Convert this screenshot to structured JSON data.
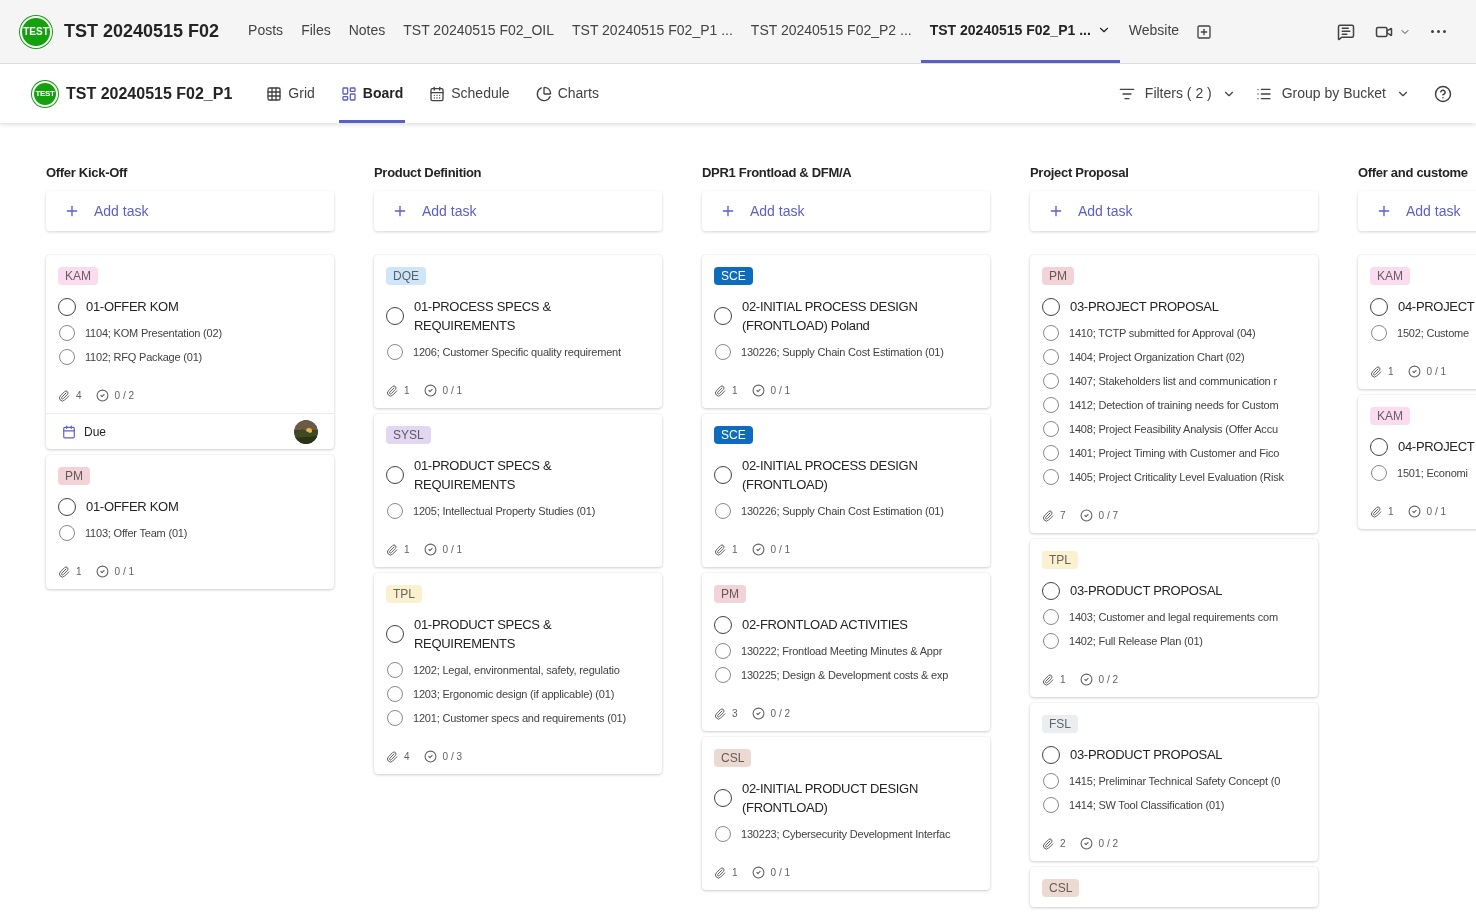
{
  "team": {
    "logo_text": "TEST",
    "name": "TST 20240515 F02"
  },
  "channel_tabs": [
    {
      "label": "Posts",
      "selected": false
    },
    {
      "label": "Files",
      "selected": false
    },
    {
      "label": "Notes",
      "selected": false
    },
    {
      "label": "TST 20240515 F02_OIL",
      "selected": false
    },
    {
      "label": "TST 20240515 F02_P1 ...",
      "selected": false
    },
    {
      "label": "TST 20240515 F02_P2 ...",
      "selected": false
    },
    {
      "label": "TST 20240515 F02_P1 ...",
      "selected": true
    },
    {
      "label": "Website",
      "selected": false
    }
  ],
  "plan": {
    "logo_text": "TEST",
    "name": "TST 20240515 F02_P1"
  },
  "views": [
    {
      "kind": "grid",
      "label": "Grid",
      "selected": false
    },
    {
      "kind": "board",
      "label": "Board",
      "selected": true
    },
    {
      "kind": "schedule",
      "label": "Schedule",
      "selected": false
    },
    {
      "kind": "charts",
      "label": "Charts",
      "selected": false
    }
  ],
  "filters": "Filters ( 2 )",
  "group_by": "Group by Bucket",
  "columns": [
    {
      "title": "Offer Kick-Off",
      "add_label": "Add task",
      "cards": [
        {
          "tag": {
            "label": "KAM",
            "color": "#fbdcef"
          },
          "title": "01-OFFER KOM",
          "done": false,
          "subtasks": [
            {
              "text": "1104; KOM Presentation (02)",
              "done": false
            },
            {
              "text": "1102; RFQ Package (01)",
              "done": false
            }
          ],
          "attachments": "4",
          "checklist": "0 / 2",
          "due": "Due"
        },
        {
          "tag": {
            "label": "PM",
            "color": "#f1d3d8"
          },
          "title": "01-OFFER KOM",
          "done": false,
          "subtasks": [
            {
              "text": "1103; Offer Team (01)",
              "done": false
            }
          ],
          "attachments": "1",
          "checklist": "0 / 1"
        }
      ]
    },
    {
      "title": "Product Definition",
      "add_label": "Add task",
      "cards": [
        {
          "tag": {
            "label": "DQE",
            "color": "#cfe6f8"
          },
          "title": "01-PROCESS SPECS & REQUIREMENTS",
          "done": false,
          "subtasks": [
            {
              "text": "1206; Customer Specific quality requirement",
              "done": false
            }
          ],
          "attachments": "1",
          "checklist": "0 / 1"
        },
        {
          "tag": {
            "label": "SYSL",
            "color": "#e3d6f0"
          },
          "title": "01-PRODUCT SPECS & REQUIREMENTS",
          "done": false,
          "subtasks": [
            {
              "text": "1205; Intellectual Property Studies (01)",
              "done": false
            }
          ],
          "attachments": "1",
          "checklist": "0 / 1"
        },
        {
          "tag": {
            "label": "TPL",
            "color": "#fbf0cf"
          },
          "title": "01-PRODUCT SPECS & REQUIREMENTS",
          "done": false,
          "subtasks": [
            {
              "text": "1202; Legal, environmental, safety, regulatio",
              "done": false
            },
            {
              "text": "1203; Ergonomic design (if applicable) (01)",
              "done": false
            },
            {
              "text": "1201; Customer specs and requirements (01)",
              "done": false
            }
          ],
          "attachments": "4",
          "checklist": "0 / 3"
        }
      ]
    },
    {
      "title": "DPR1 Frontload & DFM/A",
      "add_label": "Add task",
      "cards": [
        {
          "tag": {
            "label": "SCE",
            "color": "#0f6cbd"
          },
          "title": "02-INITIAL PROCESS DESIGN (FRONTLOAD) Poland",
          "done": false,
          "subtasks": [
            {
              "text": "130226; Supply Chain Cost Estimation (01)",
              "done": false
            }
          ],
          "attachments": "1",
          "checklist": "0 / 1"
        },
        {
          "tag": {
            "label": "SCE",
            "color": "#0f6cbd"
          },
          "title": "02-INITIAL PROCESS DESIGN (FRONTLOAD)",
          "done": false,
          "subtasks": [
            {
              "text": "130226; Supply Chain Cost Estimation (01)",
              "done": false
            }
          ],
          "attachments": "1",
          "checklist": "0 / 1"
        },
        {
          "tag": {
            "label": "PM",
            "color": "#f1d3d8"
          },
          "title": "02-FRONTLOAD ACTIVITIES",
          "done": false,
          "subtasks": [
            {
              "text": "130222; Frontload Meeting Minutes & Appr",
              "done": false
            },
            {
              "text": "130225; Design & Development costs & exp",
              "done": false
            }
          ],
          "attachments": "3",
          "checklist": "0 / 2"
        },
        {
          "tag": {
            "label": "CSL",
            "color": "#ecd9d1"
          },
          "title": "02-INITIAL PRODUCT DESIGN (FRONTLOAD)",
          "done": false,
          "subtasks": [
            {
              "text": "130223; Cybersecurity Development Interfac",
              "done": false
            }
          ],
          "attachments": "1",
          "checklist": "0 / 1"
        }
      ]
    },
    {
      "title": "Project Proposal",
      "add_label": "Add task",
      "cards": [
        {
          "tag": {
            "label": "PM",
            "color": "#f1d3d8"
          },
          "title": "03-PROJECT PROPOSAL",
          "done": false,
          "subtasks": [
            {
              "text": "1410; TCTP submitted for Approval (04)",
              "done": false
            },
            {
              "text": "1404; Project Organization Chart (02)",
              "done": false
            },
            {
              "text": "1407; Stakeholders list and communication r",
              "done": false
            },
            {
              "text": "1412; Detection of training needs for Custom",
              "done": false
            },
            {
              "text": "1408; Project Feasibility Analysis (Offer Accu",
              "done": false
            },
            {
              "text": "1401; Project Timing with Customer and Fico",
              "done": false
            },
            {
              "text": "1405; Project Criticality Level Evaluation (Risk",
              "done": false
            }
          ],
          "attachments": "7",
          "checklist": "0 / 7"
        },
        {
          "tag": {
            "label": "TPL",
            "color": "#fbf0cf"
          },
          "title": "03-PRODUCT PROPOSAL",
          "done": false,
          "subtasks": [
            {
              "text": "1403; Customer and legal requirements com",
              "done": false
            },
            {
              "text": "1402; Full Release Plan (01)",
              "done": false
            }
          ],
          "attachments": "1",
          "checklist": "0 / 2"
        },
        {
          "tag": {
            "label": "FSL",
            "color": "#eaeef0"
          },
          "title": "03-PRODUCT PROPOSAL",
          "done": false,
          "subtasks": [
            {
              "text": "1415; Preliminar Technical Safety Concept (0",
              "done": false
            },
            {
              "text": "1414; SW Tool Classification (01)",
              "done": false
            }
          ],
          "attachments": "2",
          "checklist": "0 / 2"
        },
        {
          "tag": {
            "label": "CSL",
            "color": "#ecd9d1"
          }
        }
      ]
    },
    {
      "title": "Offer and custome",
      "add_label": "Add task",
      "cards": [
        {
          "tag": {
            "label": "KAM",
            "color": "#fbdcef"
          },
          "title": "04-PROJECT",
          "done": false,
          "subtasks": [
            {
              "text": "1502; Custome",
              "done": false
            }
          ],
          "attachments": "1",
          "checklist": "0 / 1"
        },
        {
          "tag": {
            "label": "KAM",
            "color": "#fbdcef"
          },
          "title": "04-PROJECT",
          "done": false,
          "subtasks": [
            {
              "text": "1501; Economi",
              "done": false
            }
          ],
          "attachments": "1",
          "checklist": "0 / 1"
        }
      ]
    }
  ]
}
